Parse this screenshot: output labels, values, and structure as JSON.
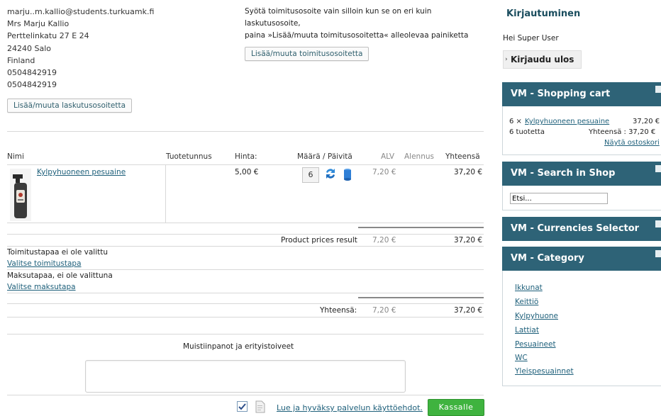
{
  "billing": {
    "email": "marju..m.kallio@students.turkuamk.fi",
    "name": "Mrs Marju Kallio",
    "street": "Perttelinkatu 27 E 24",
    "city": "24240 Salo",
    "country": "Finland",
    "phone1": "0504842919",
    "phone2": "0504842919",
    "button": "Lisää/muuta laskutusosoitetta"
  },
  "shipping": {
    "info1": "Syötä toimitusosoite vain silloin kun se on eri kuin",
    "info2": "laskutusosoite,",
    "info3": "paina »Lisää/muuta toimitusosoitetta« alleolevaa painiketta",
    "button": "Lisää/muuta toimitusosoitetta"
  },
  "cart_table": {
    "headers": {
      "name": "Nimi",
      "sku": "Tuotetunnus",
      "price": "Hinta:",
      "qty": "Määrä / Päivitä",
      "vat": "ALV",
      "discount": "Alennus",
      "total": "Yhteensä"
    },
    "item": {
      "name": "Kylpyhuoneen pesuaine",
      "price": "5,00 €",
      "quantity": "6",
      "vat": "7,20 €",
      "total": "37,20 €"
    },
    "product_prices_label": "Product prices result",
    "product_prices_vat": "7,20 €",
    "product_prices_total": "37,20 €",
    "shipping_text": "Toimitustapaa ei ole valittu",
    "shipping_link": "Valitse toimitustapa",
    "payment_text": "Maksutapaa, ei ole valittuna",
    "payment_link": "Valitse maksutapa",
    "grand_label": "Yhteensä:",
    "grand_vat": "7,20 €",
    "grand_total": "37,20 €"
  },
  "notes": {
    "label": "Muistiinpanot ja erityistoiveet",
    "value": ""
  },
  "checkout": {
    "terms_link": "Lue ja hyväksy palvelun käyttöehdot.",
    "button": "Kassalle"
  },
  "sidebar": {
    "login_title": "Kirjautuminen",
    "greeting": "Hei Super User",
    "logout_button": "Kirjaudu ulos",
    "cart_title": "VM - Shopping cart",
    "cart_line_qty": "6 ×",
    "cart_line_link": "Kylpyhuoneen pesuaine",
    "cart_line_price": "37,20 €",
    "cart_count": "6 tuotetta",
    "cart_total": "Yhteensä : 37,20 €",
    "cart_show": "Näytä ostoskori",
    "search_title": "VM - Search in Shop",
    "search_placeholder": "Etsi...",
    "currency_title": "VM - Currencies Selector",
    "category_title": "VM - Category",
    "categories": [
      "Ikkunat",
      "Keittiö",
      "Kylpyhuone",
      "Lattiat",
      "Pesuaineet",
      "WC",
      "Yleispesuainnet"
    ]
  },
  "colors": {
    "module_header": "#2e6377",
    "checkout_button": "#3fb33f",
    "link": "#1d5f7a"
  }
}
